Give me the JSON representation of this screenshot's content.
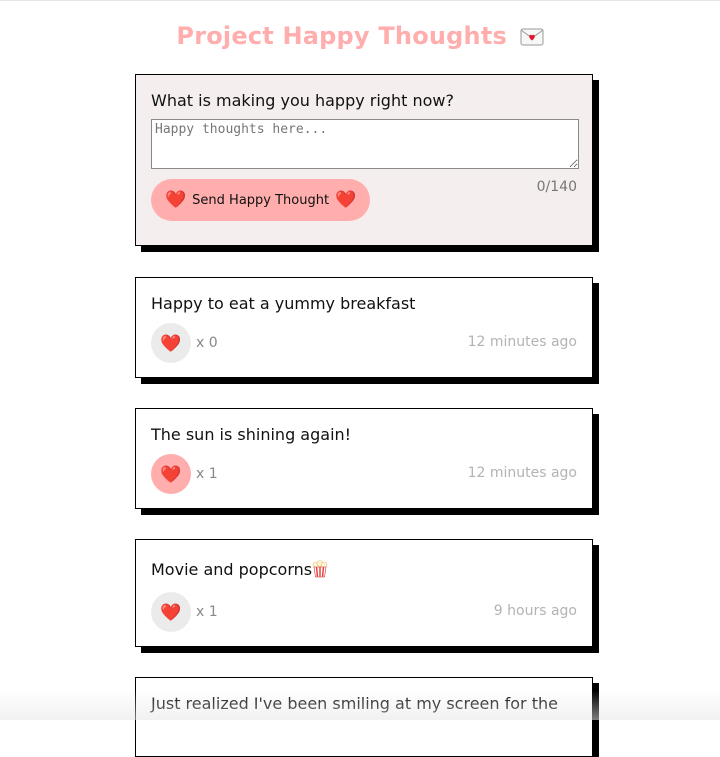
{
  "header": {
    "title": "Project Happy Thoughts",
    "title_icon": "envelope-heart-icon"
  },
  "form": {
    "question": "What is making you happy right now?",
    "placeholder": "Happy thoughts here...",
    "value": "",
    "char_count": "0/140",
    "send_label": "Send Happy Thought",
    "heart_glyph": "❤️"
  },
  "thoughts": [
    {
      "text": "Happy to eat a yummy breakfast",
      "likes": "x 0",
      "liked": false,
      "time": "12 minutes ago"
    },
    {
      "text": "The sun is shining again!",
      "likes": "x 1",
      "liked": true,
      "time": "12 minutes ago"
    },
    {
      "text": "Movie and popcorns",
      "likes": "x 1",
      "liked": false,
      "time": "9 hours ago",
      "icon": "popcorn-icon"
    },
    {
      "text": "Just realized I've been smiling at my screen for the",
      "likes": "",
      "liked": false,
      "time": ""
    }
  ],
  "colors": {
    "accent": "#ffadad",
    "form_bg": "#f4efee",
    "heart": "#e0142b"
  }
}
